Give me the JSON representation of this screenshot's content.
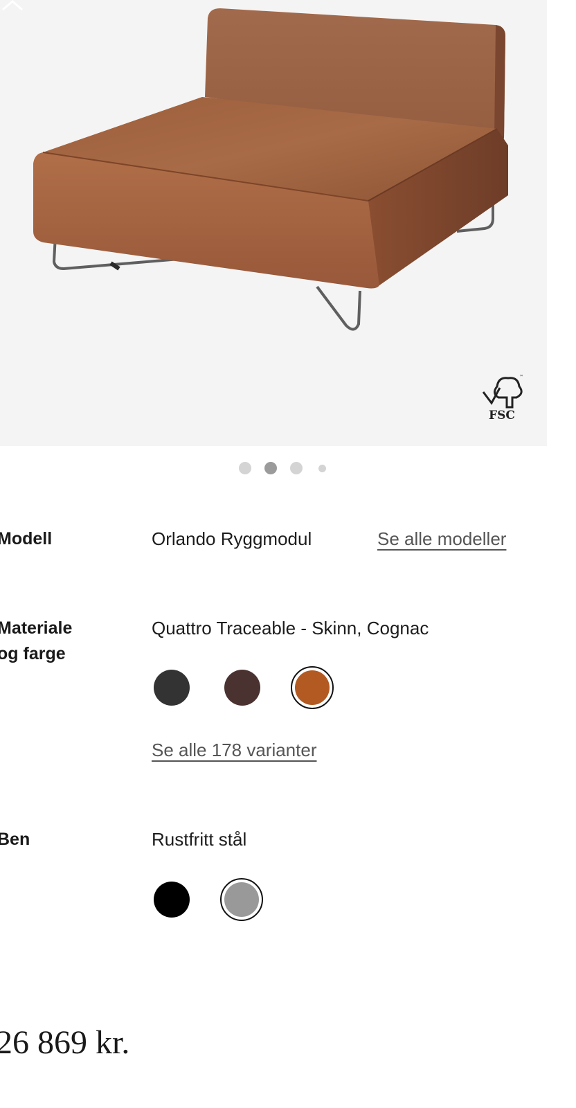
{
  "product": {
    "image_alt": "",
    "fsc_label": "FSC"
  },
  "carousel": {
    "count": 4,
    "active_index": 1
  },
  "model": {
    "label": "Modell",
    "value": "Orlando Ryggmodul",
    "link": "Se alle modeller"
  },
  "material": {
    "label_line1": "Materiale",
    "label_line2": "og farge",
    "value": "Quattro Traceable - Skinn, Cognac",
    "swatches": [
      {
        "name": "dark-grey",
        "color": "#333333",
        "selected": false
      },
      {
        "name": "dark-brown",
        "color": "#4a3230",
        "selected": false
      },
      {
        "name": "cognac",
        "color": "#b25a22",
        "selected": true
      }
    ],
    "variants_link": "Se alle 178 varianter"
  },
  "legs": {
    "label": "Ben",
    "value": "Rustfritt stål",
    "swatches": [
      {
        "name": "black",
        "color": "#000000",
        "selected": false
      },
      {
        "name": "stainless-steel",
        "color": "#999999",
        "selected": true
      }
    ]
  },
  "price": "26 869 kr."
}
